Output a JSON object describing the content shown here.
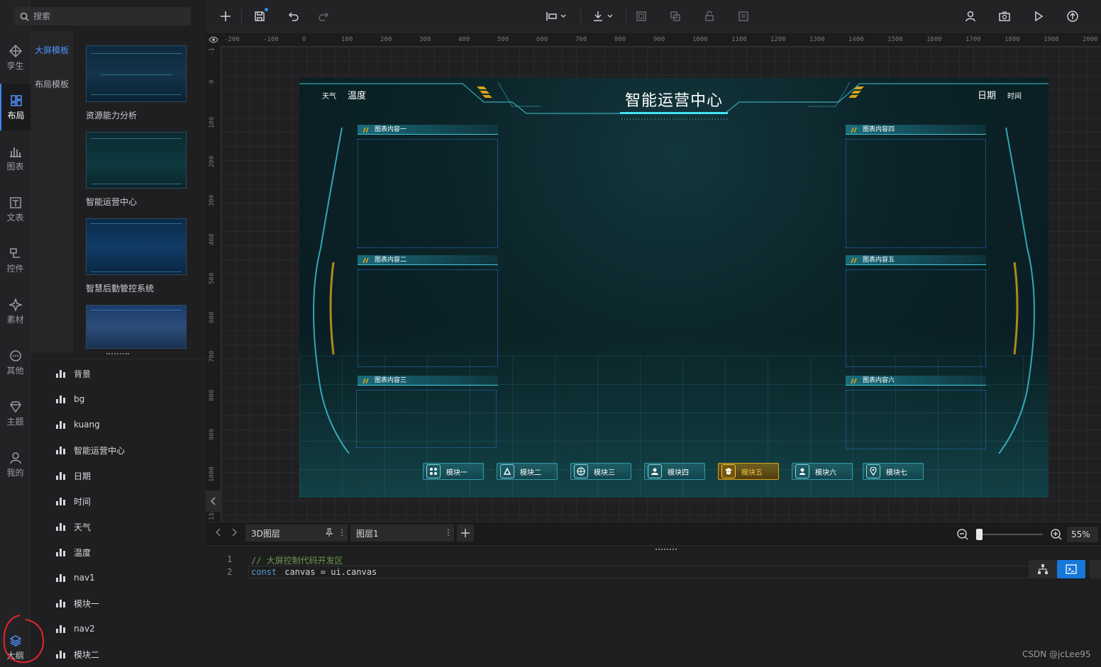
{
  "search": {
    "placeholder": "搜索"
  },
  "rail": {
    "items": [
      {
        "id": "twin",
        "label": "孪生",
        "icon": "diamond-icon"
      },
      {
        "id": "layout",
        "label": "布局",
        "icon": "layout-icon",
        "active": true
      },
      {
        "id": "chart",
        "label": "图表",
        "icon": "bar-chart-icon"
      },
      {
        "id": "text",
        "label": "文表",
        "icon": "text-icon"
      },
      {
        "id": "control",
        "label": "控件",
        "icon": "control-icon"
      },
      {
        "id": "material",
        "label": "素材",
        "icon": "sparkle-icon"
      },
      {
        "id": "other",
        "label": "其他",
        "icon": "more-icon"
      },
      {
        "id": "theme",
        "label": "主题",
        "icon": "gem-icon"
      },
      {
        "id": "mine",
        "label": "我的",
        "icon": "user-icon"
      },
      {
        "id": "outline",
        "label": "大纲",
        "icon": "layers-icon"
      }
    ]
  },
  "templates": {
    "categories": [
      {
        "label": "大屏模板",
        "active": true
      },
      {
        "label": "布局模板"
      }
    ],
    "items": [
      {
        "name": "资源能力分析"
      },
      {
        "name": "智能运营中心"
      },
      {
        "name": "智慧后勤管控系统"
      },
      {
        "name": ""
      }
    ]
  },
  "layers": [
    "背景",
    "bg",
    "kuang",
    "智能运营中心",
    "日期",
    "时间",
    "天气",
    "温度",
    "nav1",
    "模块一",
    "nav2",
    "模块二"
  ],
  "ruler": {
    "top": [
      "-200",
      "-100",
      "0",
      "100",
      "200",
      "300",
      "400",
      "500",
      "600",
      "700",
      "800",
      "900",
      "1000",
      "1100",
      "1200",
      "1300",
      "1400",
      "1500",
      "1600",
      "1700",
      "1800",
      "1900",
      "2000"
    ],
    "left": [
      "-1",
      "0",
      "100",
      "200",
      "300",
      "400",
      "500",
      "600",
      "700",
      "800",
      "900",
      "1000",
      "110"
    ]
  },
  "dashboard": {
    "title": "智能运营中心",
    "weather": "天气",
    "temperature": "温度",
    "date": "日期",
    "time": "时间",
    "panels_left": [
      "图表内容一",
      "图表内容二",
      "图表内容三"
    ],
    "panels_right": [
      "图表内容四",
      "图表内容五",
      "图表内容六"
    ],
    "modules": [
      {
        "label": "模块一",
        "active": false
      },
      {
        "label": "模块二",
        "active": false
      },
      {
        "label": "模块三",
        "active": false
      },
      {
        "label": "模块四",
        "active": false
      },
      {
        "label": "模块五",
        "active": true
      },
      {
        "label": "模块六",
        "active": false
      },
      {
        "label": "模块七",
        "active": false
      }
    ],
    "colors": {
      "accent": "#3ec8d8",
      "active": "#d9a419",
      "bg": "#0b2327"
    }
  },
  "tabs": [
    {
      "label": "3D图层"
    },
    {
      "label": "图层1"
    }
  ],
  "zoom": {
    "value": "55%",
    "level": 0.55
  },
  "editor": {
    "line_numbers": [
      "1",
      "2"
    ],
    "line1_comment": "// 大屏控制代码开发区",
    "line2_keyword": "const",
    "line2_rest": " canvas = ui.canvas"
  },
  "watermark": "CSDN @jcLee95"
}
